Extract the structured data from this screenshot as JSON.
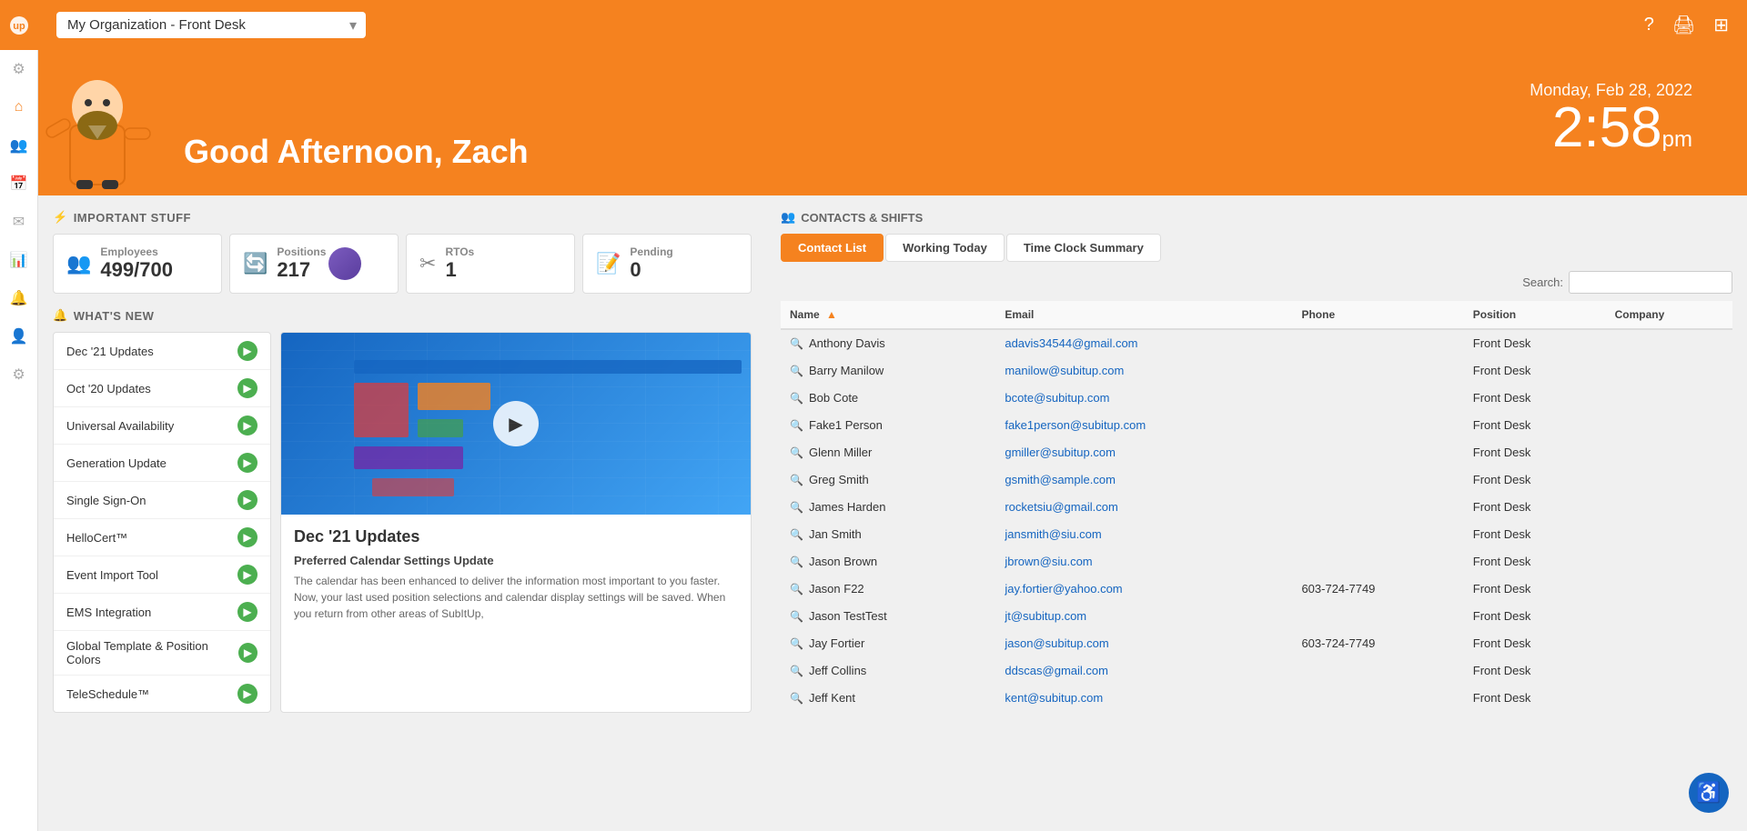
{
  "sidebar": {
    "logo": "UP",
    "items": [
      {
        "name": "settings",
        "icon": "⚙",
        "label": "Settings"
      },
      {
        "name": "home",
        "icon": "⌂",
        "label": "Home"
      },
      {
        "name": "team",
        "icon": "👥",
        "label": "Team"
      },
      {
        "name": "calendar",
        "icon": "📅",
        "label": "Calendar"
      },
      {
        "name": "messages",
        "icon": "✉",
        "label": "Messages"
      },
      {
        "name": "charts",
        "icon": "📊",
        "label": "Charts"
      },
      {
        "name": "alerts",
        "icon": "🔔",
        "label": "Alerts"
      },
      {
        "name": "user",
        "icon": "👤",
        "label": "User"
      },
      {
        "name": "settings2",
        "icon": "⚙",
        "label": "Settings 2"
      }
    ]
  },
  "topbar": {
    "org_selector": "My Organization - Front Desk",
    "icons": [
      "?",
      "🖨",
      "⊞"
    ]
  },
  "hero": {
    "greeting": "Good Afternoon, Zach",
    "date": "Monday, Feb 28, 2022",
    "time": "2:58",
    "time_suffix": "pm",
    "mascot_alt": "Zach mascot character"
  },
  "important_stuff": {
    "title": "IMPORTANT STUFF",
    "stats": [
      {
        "label": "Employees",
        "value": "499/700",
        "icon": "👥"
      },
      {
        "label": "Positions",
        "value": "217",
        "icon": "🔄"
      },
      {
        "label": "RTOs",
        "value": "1",
        "icon": "✂"
      },
      {
        "label": "Pending",
        "value": "0",
        "icon": "📝"
      }
    ]
  },
  "whats_new": {
    "title": "WHAT'S NEW",
    "items": [
      {
        "label": "Dec '21 Updates"
      },
      {
        "label": "Oct '20 Updates"
      },
      {
        "label": "Universal Availability"
      },
      {
        "label": "Generation Update"
      },
      {
        "label": "Single Sign-On"
      },
      {
        "label": "HelloCert™"
      },
      {
        "label": "Event Import Tool"
      },
      {
        "label": "EMS Integration"
      },
      {
        "label": "Global Template & Position Colors"
      },
      {
        "label": "TeleSchedule™"
      }
    ]
  },
  "video": {
    "title": "Dec '21 Updates",
    "subtitle": "Preferred Calendar Settings Update",
    "description": "The calendar has been enhanced to deliver the information most important to you faster. Now, your last used position selections and calendar display settings will be saved. When you return from other areas of SubItUp,"
  },
  "contacts": {
    "section_title": "CONTACTS & SHIFTS",
    "tabs": [
      {
        "label": "Contact List",
        "active": true
      },
      {
        "label": "Working Today",
        "active": false
      },
      {
        "label": "Time Clock Summary",
        "active": false
      }
    ],
    "search_label": "Search:",
    "columns": [
      {
        "label": "Name",
        "sort": true
      },
      {
        "label": "Email",
        "sort": false
      },
      {
        "label": "Phone",
        "sort": false
      },
      {
        "label": "Position",
        "sort": false
      },
      {
        "label": "Company",
        "sort": false
      }
    ],
    "rows": [
      {
        "name": "Anthony Davis",
        "email": "adavis34544@gmail.com",
        "phone": "",
        "position": "Front Desk",
        "company": ""
      },
      {
        "name": "Barry Manilow",
        "email": "manilow@subitup.com",
        "phone": "",
        "position": "Front Desk",
        "company": ""
      },
      {
        "name": "Bob Cote",
        "email": "bcote@subitup.com",
        "phone": "",
        "position": "Front Desk",
        "company": ""
      },
      {
        "name": "Fake1 Person",
        "email": "fake1person@subitup.com",
        "phone": "",
        "position": "Front Desk",
        "company": ""
      },
      {
        "name": "Glenn Miller",
        "email": "gmiller@subitup.com",
        "phone": "",
        "position": "Front Desk",
        "company": ""
      },
      {
        "name": "Greg Smith",
        "email": "gsmith@sample.com",
        "phone": "",
        "position": "Front Desk",
        "company": ""
      },
      {
        "name": "James Harden",
        "email": "rocketsiu@gmail.com",
        "phone": "",
        "position": "Front Desk",
        "company": ""
      },
      {
        "name": "Jan Smith",
        "email": "jansmith@siu.com",
        "phone": "",
        "position": "Front Desk",
        "company": ""
      },
      {
        "name": "Jason Brown",
        "email": "jbrown@siu.com",
        "phone": "",
        "position": "Front Desk",
        "company": ""
      },
      {
        "name": "Jason F22",
        "email": "jay.fortier@yahoo.com",
        "phone": "603-724-7749",
        "position": "Front Desk",
        "company": ""
      },
      {
        "name": "Jason TestTest",
        "email": "jt@subitup.com",
        "phone": "",
        "position": "Front Desk",
        "company": ""
      },
      {
        "name": "Jay Fortier",
        "email": "jason@subitup.com",
        "phone": "603-724-7749",
        "position": "Front Desk",
        "company": ""
      },
      {
        "name": "Jeff Collins",
        "email": "ddscas@gmail.com",
        "phone": "",
        "position": "Front Desk",
        "company": ""
      },
      {
        "name": "Jeff Kent",
        "email": "kent@subitup.com",
        "phone": "",
        "position": "Front Desk",
        "company": ""
      }
    ]
  },
  "accessibility": {
    "label": "♿"
  }
}
